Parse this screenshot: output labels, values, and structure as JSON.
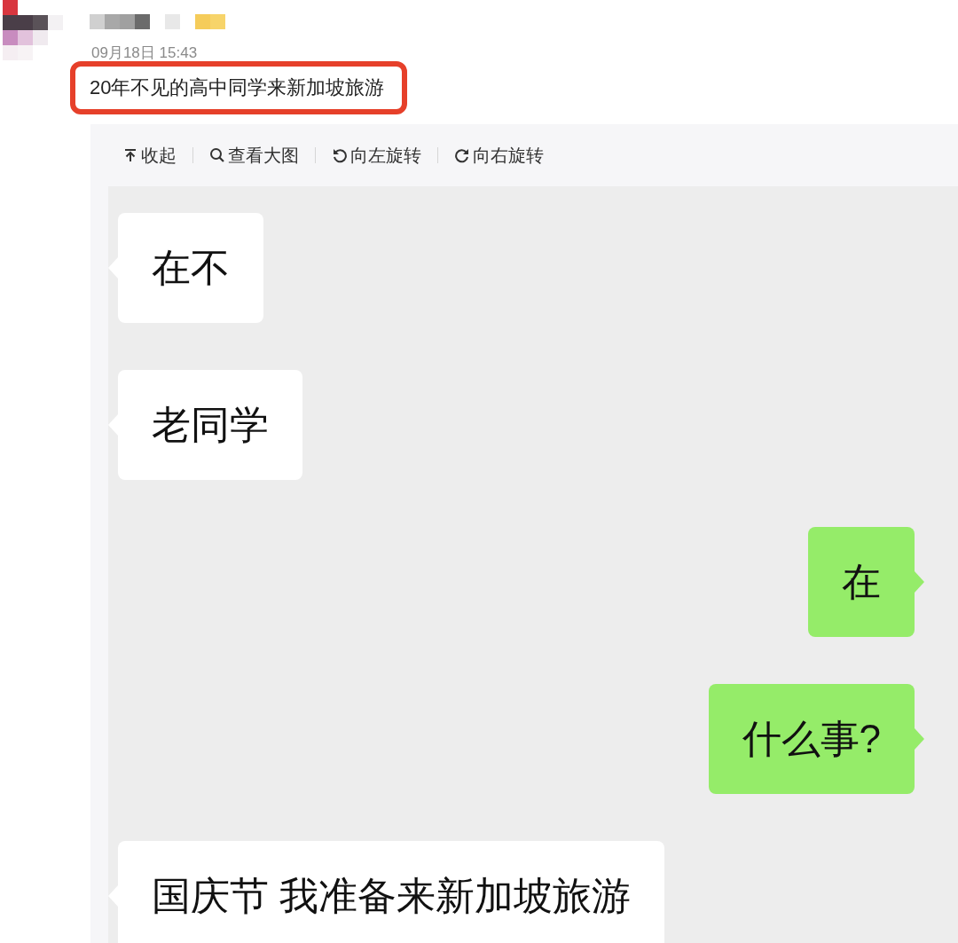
{
  "post": {
    "date": "09月18日 15:43",
    "text": "20年不见的高中同学来新加坡旅游"
  },
  "toolbar": [
    {
      "kind": "collapse",
      "label": "收起"
    },
    {
      "kind": "zoom",
      "label": "查看大图"
    },
    {
      "kind": "rotate-left",
      "label": "向左旋转"
    },
    {
      "kind": "rotate-right",
      "label": "向右旋转"
    }
  ],
  "messages": [
    {
      "kind": "received",
      "text": "在不"
    },
    {
      "kind": "received",
      "text": "老同学"
    },
    {
      "kind": "sent",
      "text": "在"
    },
    {
      "kind": "sent",
      "text": "什么事?"
    },
    {
      "kind": "received",
      "text": "国庆节 我准备来新加坡旅游"
    }
  ]
}
